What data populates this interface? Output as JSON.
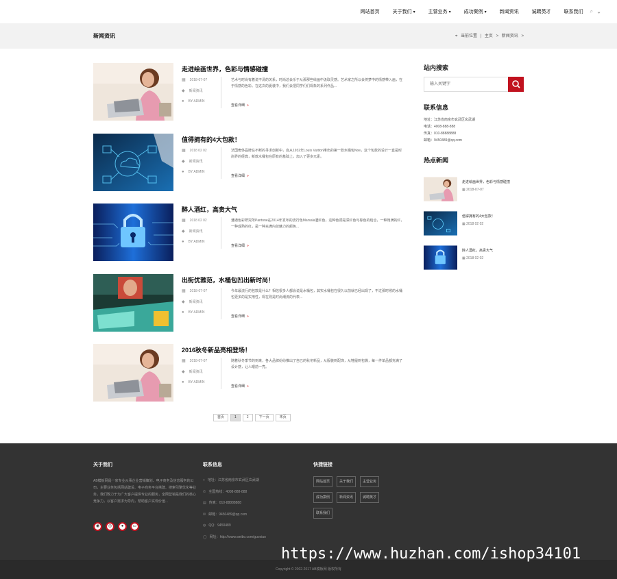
{
  "nav": {
    "items": [
      {
        "label": "网站首页",
        "caret": false
      },
      {
        "label": "关于我们",
        "caret": true
      },
      {
        "label": "主营业务",
        "caret": true
      },
      {
        "label": "成功案例",
        "caret": true
      },
      {
        "label": "新闻资讯",
        "caret": false
      },
      {
        "label": "诚聘英才",
        "caret": false
      },
      {
        "label": "联系我们",
        "caret": false
      }
    ]
  },
  "breadcrumb": {
    "title": "新闻资讯",
    "location_label": "当前位置",
    "home": "主页",
    "current": "新闻资讯"
  },
  "articles": [
    {
      "title": "走进绘画世界，色彩与情感碰撞",
      "date": "2018-07-07",
      "category": "新闻资讯",
      "author": "BY ADMIN",
      "excerpt": "艺术与时尚有着说不清的关系，时尚总会乐于从那那些绘画中汲取灵感。艺术家之所以会将梦中的情感带入画，在于情感的色彩。在这次的夏装中，我们会把同学们们现象的系列作品...",
      "more": "查看详细",
      "thumb": "woman-laptop"
    },
    {
      "title": "值得拥有的4大包款！",
      "date": "2018 02 02",
      "category": "新闻资讯",
      "author": "BY ADMIN",
      "excerpt": "法国奢侈品牌在不断的寻求创新中，自从1932年Louis Vuitton推出的第一款水桶包Noe，这个包款的设计一直是时尚界的经典，新款水桶包在原有的基础上，加入了更多元素。",
      "more": "查看详细",
      "thumb": "tech-cloud"
    },
    {
      "title": "醉人酒红，高贵大气",
      "date": "2018 02 02",
      "category": "新闻资讯",
      "author": "BY ADMIN",
      "excerpt": "潘通色彩研究所Pantone在2014年发布的流行色Marsala酒红色，这种色调是深红色与棕色的结合，一种饱满的红，一种成熟的红，是一种充满内敛魅力的颜色...",
      "more": "查看详细",
      "thumb": "padlock"
    },
    {
      "title": "出街优雅范，水桶包凹出新时尚！",
      "date": "2018-07-07",
      "category": "新闻资讯",
      "author": "BY ADMIN",
      "excerpt": "今年最流行的包款是什么？相信很多人都会说是水桶包，其实水桶包在很久以前就已经出现了，不过那时候的水桶包更多的是实用性，现在则是时尚潮流的代表...",
      "more": "查看详细",
      "thumb": "man-screens"
    },
    {
      "title": "2016秋冬新品亮相登场！",
      "date": "2018-07-07",
      "category": "新闻资讯",
      "author": "BY ADMIN",
      "excerpt": "随着秋冬季节的到来，各大品牌纷纷推出了自己的秋冬新品，从服装到配饰，从鞋履到包袋，每一件单品都充满了设计感，让人眼前一亮。",
      "more": "查看详细",
      "thumb": "woman-laptop"
    }
  ],
  "pagination": {
    "first": "首页",
    "pages": [
      "1",
      "2"
    ],
    "next": "下一页",
    "last": "末页"
  },
  "sidebar": {
    "search_title": "站内搜索",
    "search_placeholder": "输入关键字",
    "contact_title": "联系信息",
    "contact_lines": [
      "地址：江苏省南京市玄武区玄武湖",
      "电话：4008-888-888",
      "传真：010-88888888",
      "邮箱：9450489@qq.com"
    ],
    "hot_title": "热点新闻",
    "hot_news": [
      {
        "title": "走进绘画世界，色彩与情感碰撞",
        "date": "2018-07-07",
        "thumb": "woman-laptop"
      },
      {
        "title": "值得拥有的4大包款！",
        "date": "2018 02 02",
        "thumb": "tech-cloud"
      },
      {
        "title": "醉人酒红，高贵大气",
        "date": "2018 02 02",
        "thumb": "padlock"
      }
    ]
  },
  "footer": {
    "about_title": "关于我们",
    "about_text": "AB模板网是一家专业从事企业营销策划、电子商务及信息服务的公司，主要业务包括网站建设、电子商务平台搭建、搜索引擎优化等业务，我们致力于为广大客户提供专业的服务，全网营销是我们的核心竞争力，以客户需求为导向，帮助客户实现价值...",
    "contact_title": "联系信息",
    "contact_items": [
      {
        "icon": "map-pin-icon",
        "text": "地址：江苏省南京市玄武区玄武湖"
      },
      {
        "icon": "phone-icon",
        "text": "全国热线：4008-888-888"
      },
      {
        "icon": "fax-icon",
        "text": "传真：010-88888888"
      },
      {
        "icon": "mail-icon",
        "text": "邮箱：9450489@qq.com"
      },
      {
        "icon": "qq-icon",
        "text": "QQ：9450489"
      },
      {
        "icon": "globe-icon",
        "text": "网址：http://www.weibo.com/guoxiao"
      }
    ],
    "links_title": "快捷链接",
    "links": [
      "网站首页",
      "关于我们",
      "主营业务",
      "成功案例",
      "新闻资讯",
      "诚聘英才",
      "联系我们"
    ],
    "copyright": "Copyright © 2002-2017 AB模板网 版权所有"
  },
  "watermark": "https://www.huzhan.com/ishop34101",
  "colors": {
    "accent": "#c1121f",
    "footer_bg": "#333333",
    "crumb_bg": "#f2f2f2"
  }
}
